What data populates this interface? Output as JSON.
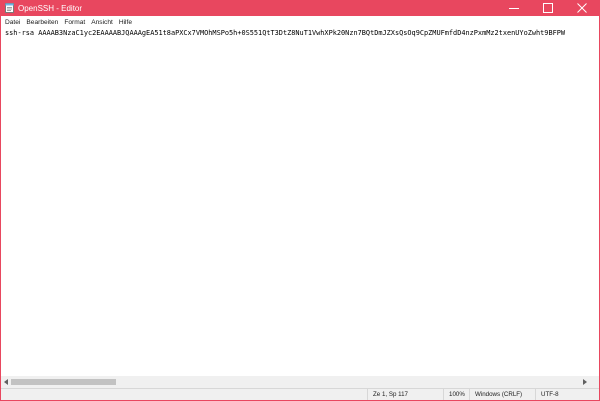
{
  "window": {
    "title": "OpenSSH - Editor",
    "accent_color": "#e8475f",
    "controls": {
      "minimize_icon": "minimize-icon",
      "maximize_icon": "maximize-icon",
      "close_icon": "close-icon"
    }
  },
  "menubar": {
    "items": [
      {
        "label": "Datei"
      },
      {
        "label": "Bearbeiten"
      },
      {
        "label": "Format"
      },
      {
        "label": "Ansicht"
      },
      {
        "label": "Hilfe"
      }
    ]
  },
  "editor": {
    "content": "ssh-rsa AAAAB3NzaC1yc2EAAAABJQAAAgEA51t8aPXCx7VMOhMSPo5h+0S551QtT3DtZ8NuT1VwhXPk20Nzn7BQtDmJZXsQsOq9CpZMUFmfdD4nzPxmMz2txenUYoZwht9BFPW"
  },
  "statusbar": {
    "position": "Ze 1, Sp 117",
    "zoom": "100%",
    "line_ending": "Windows (CRLF)",
    "encoding": "UTF-8"
  }
}
